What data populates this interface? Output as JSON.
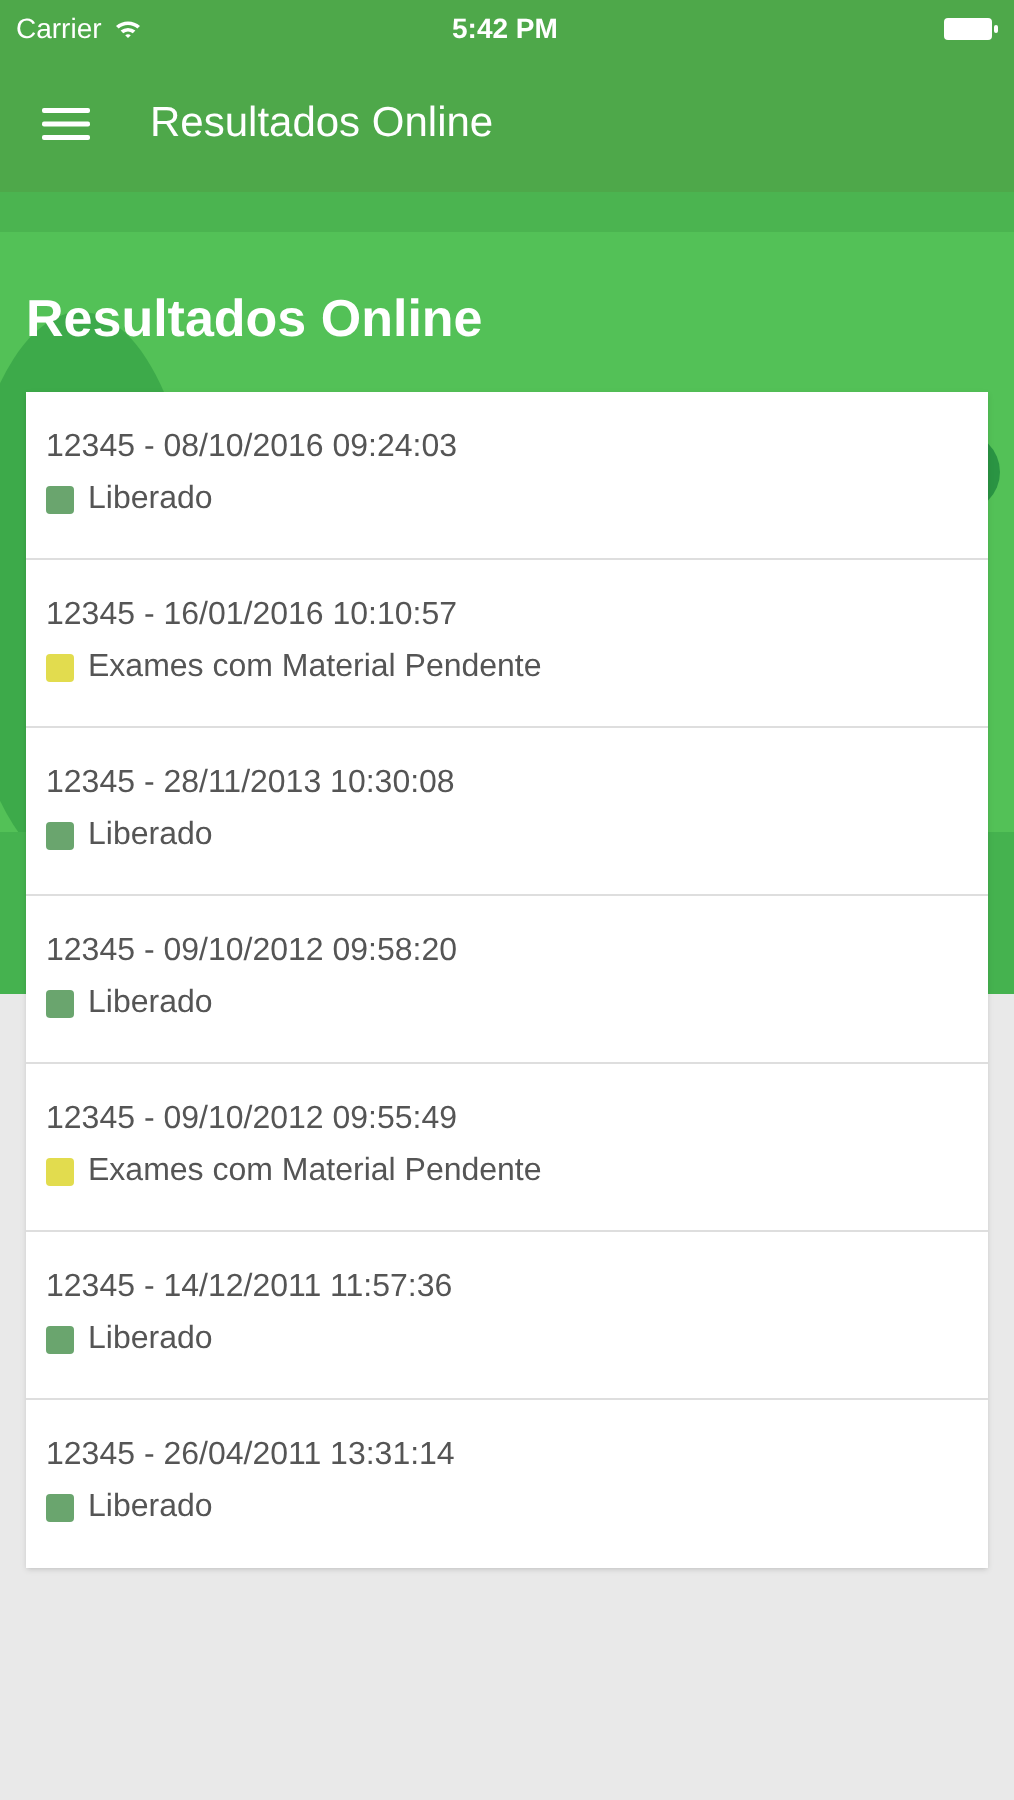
{
  "status_bar": {
    "carrier": "Carrier",
    "time": "5:42 PM"
  },
  "nav_bar": {
    "title": "Resultados Online"
  },
  "header": {
    "title": "Resultados Online"
  },
  "results": [
    {
      "title": "12345 - 08/10/2016 09:24:03",
      "status": "Liberado",
      "color": "#6aa56e"
    },
    {
      "title": "12345 - 16/01/2016 10:10:57",
      "status": "Exames com Material Pendente",
      "color": "#e2dc4e"
    },
    {
      "title": "12345 - 28/11/2013 10:30:08",
      "status": "Liberado",
      "color": "#6aa56e"
    },
    {
      "title": "12345 - 09/10/2012 09:58:20",
      "status": "Liberado",
      "color": "#6aa56e"
    },
    {
      "title": "12345 - 09/10/2012 09:55:49",
      "status": "Exames com Material Pendente",
      "color": "#e2dc4e"
    },
    {
      "title": "12345 - 14/12/2011 11:57:36",
      "status": "Liberado",
      "color": "#6aa56e"
    },
    {
      "title": "12345 - 26/04/2011 13:31:14",
      "status": "Liberado",
      "color": "#6aa56e"
    }
  ]
}
